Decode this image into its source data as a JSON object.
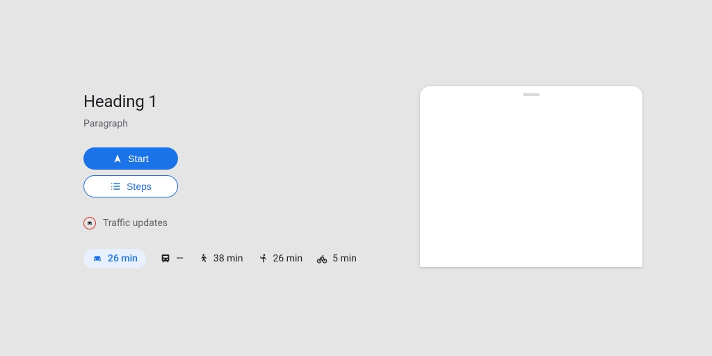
{
  "header": {
    "heading": "Heading 1",
    "paragraph": "Paragraph"
  },
  "buttons": {
    "start_label": "Start",
    "steps_label": "Steps"
  },
  "updates_label": "Traffic updates",
  "modes": {
    "drive_time": "26 min",
    "transit_time": "—",
    "walk_time": "38 min",
    "ride_time": "26 min",
    "bike_time": "5 min"
  }
}
